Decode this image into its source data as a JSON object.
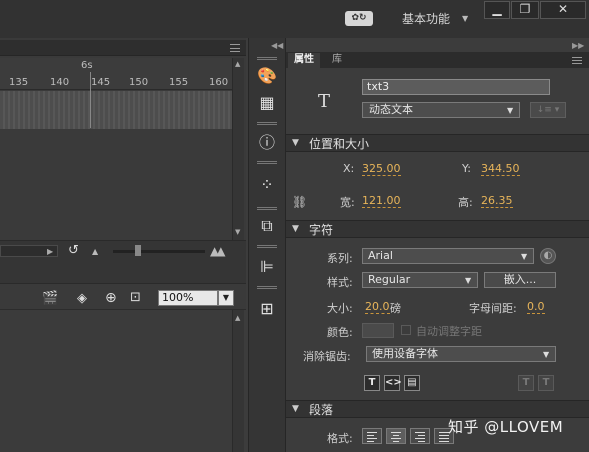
{
  "topbar": {
    "workspace_label": "基本功能",
    "sync_button_label": "✿↻",
    "minimize": "▁",
    "restore": "❐",
    "close": "✕"
  },
  "timeline": {
    "seconds_label": "6s",
    "ruler_ticks": [
      "135",
      "140",
      "145",
      "150",
      "155",
      "160"
    ]
  },
  "editor": {
    "zoom_value": "100%"
  },
  "properties": {
    "tabs": [
      "属性",
      "库"
    ],
    "instance_name": "txt3",
    "text_type": "动态文本",
    "position_size": {
      "title": "位置和大小",
      "x_label": "X:",
      "x_value": "325.00",
      "y_label": "Y:",
      "y_value": "344.50",
      "width_label": "宽:",
      "width_value": "121.00",
      "height_label": "高:",
      "height_value": "26.35"
    },
    "character": {
      "title": "字符",
      "family_label": "系列:",
      "family_value": "Arial",
      "style_label": "样式:",
      "style_value": "Regular",
      "embed_button": "嵌入...",
      "size_label": "大小:",
      "size_value": "20.0",
      "size_unit": "磅",
      "letter_spacing_label": "字母间距:",
      "letter_spacing_value": "0.0",
      "color_label": "颜色:",
      "auto_kern_label": "自动调整字距",
      "antialias_label": "消除锯齿:",
      "antialias_value": "使用设备字体"
    },
    "paragraph": {
      "title": "段落",
      "format_label": "格式:"
    }
  },
  "watermark": "知乎 @LLOVEM"
}
